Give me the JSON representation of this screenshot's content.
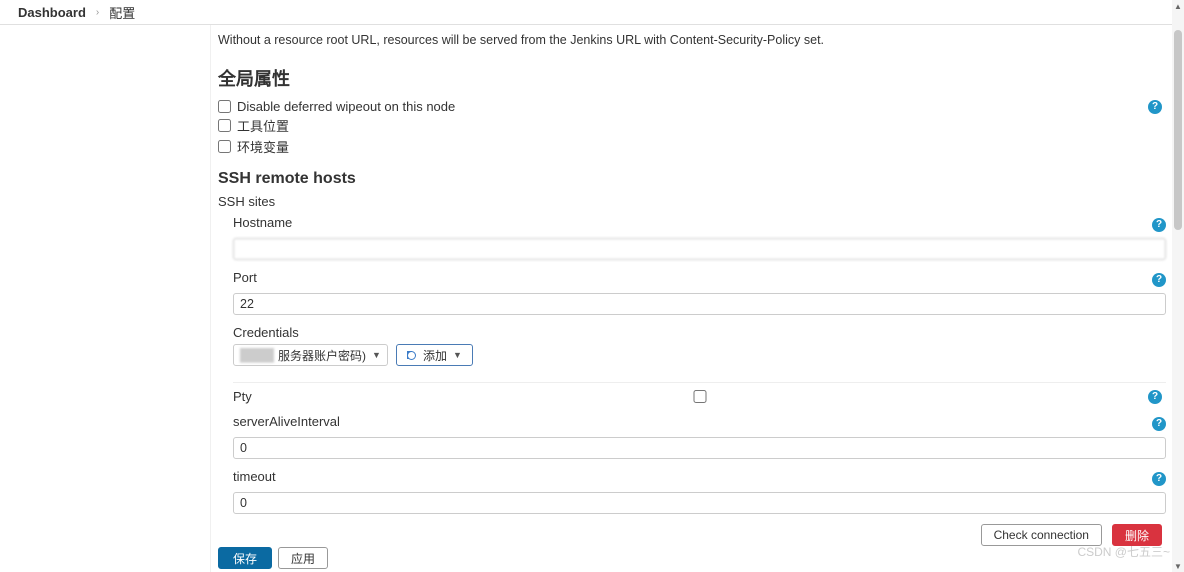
{
  "breadcrumb": {
    "item1": "Dashboard",
    "item2": "配置"
  },
  "helpText": "Without a resource root URL, resources will be served from the Jenkins URL with Content-Security-Policy set.",
  "sections": {
    "globalProps": {
      "title": "全局属性",
      "checks": [
        {
          "label": "Disable deferred wipeout on this node",
          "help": true
        },
        {
          "label": "工具位置",
          "help": false
        },
        {
          "label": "环境变量",
          "help": false
        }
      ]
    },
    "ssh": {
      "title": "SSH remote hosts",
      "sitesLabel": "SSH sites",
      "fields": {
        "hostname": {
          "label": "Hostname",
          "value": ""
        },
        "port": {
          "label": "Port",
          "value": "22"
        },
        "credentials": {
          "label": "Credentials",
          "selected": "服务器账户密码)",
          "addLabel": "添加"
        },
        "pty": {
          "label": "Pty"
        },
        "serverAliveInterval": {
          "label": "serverAliveInterval",
          "value": "0"
        },
        "timeout": {
          "label": "timeout",
          "value": "0"
        }
      },
      "actions": {
        "checkConnection": "Check connection",
        "delete": "删除"
      }
    }
  },
  "buttons": {
    "save": "保存",
    "apply": "应用"
  },
  "helpIconGlyph": "?",
  "watermark": "CSDN @七五三~"
}
